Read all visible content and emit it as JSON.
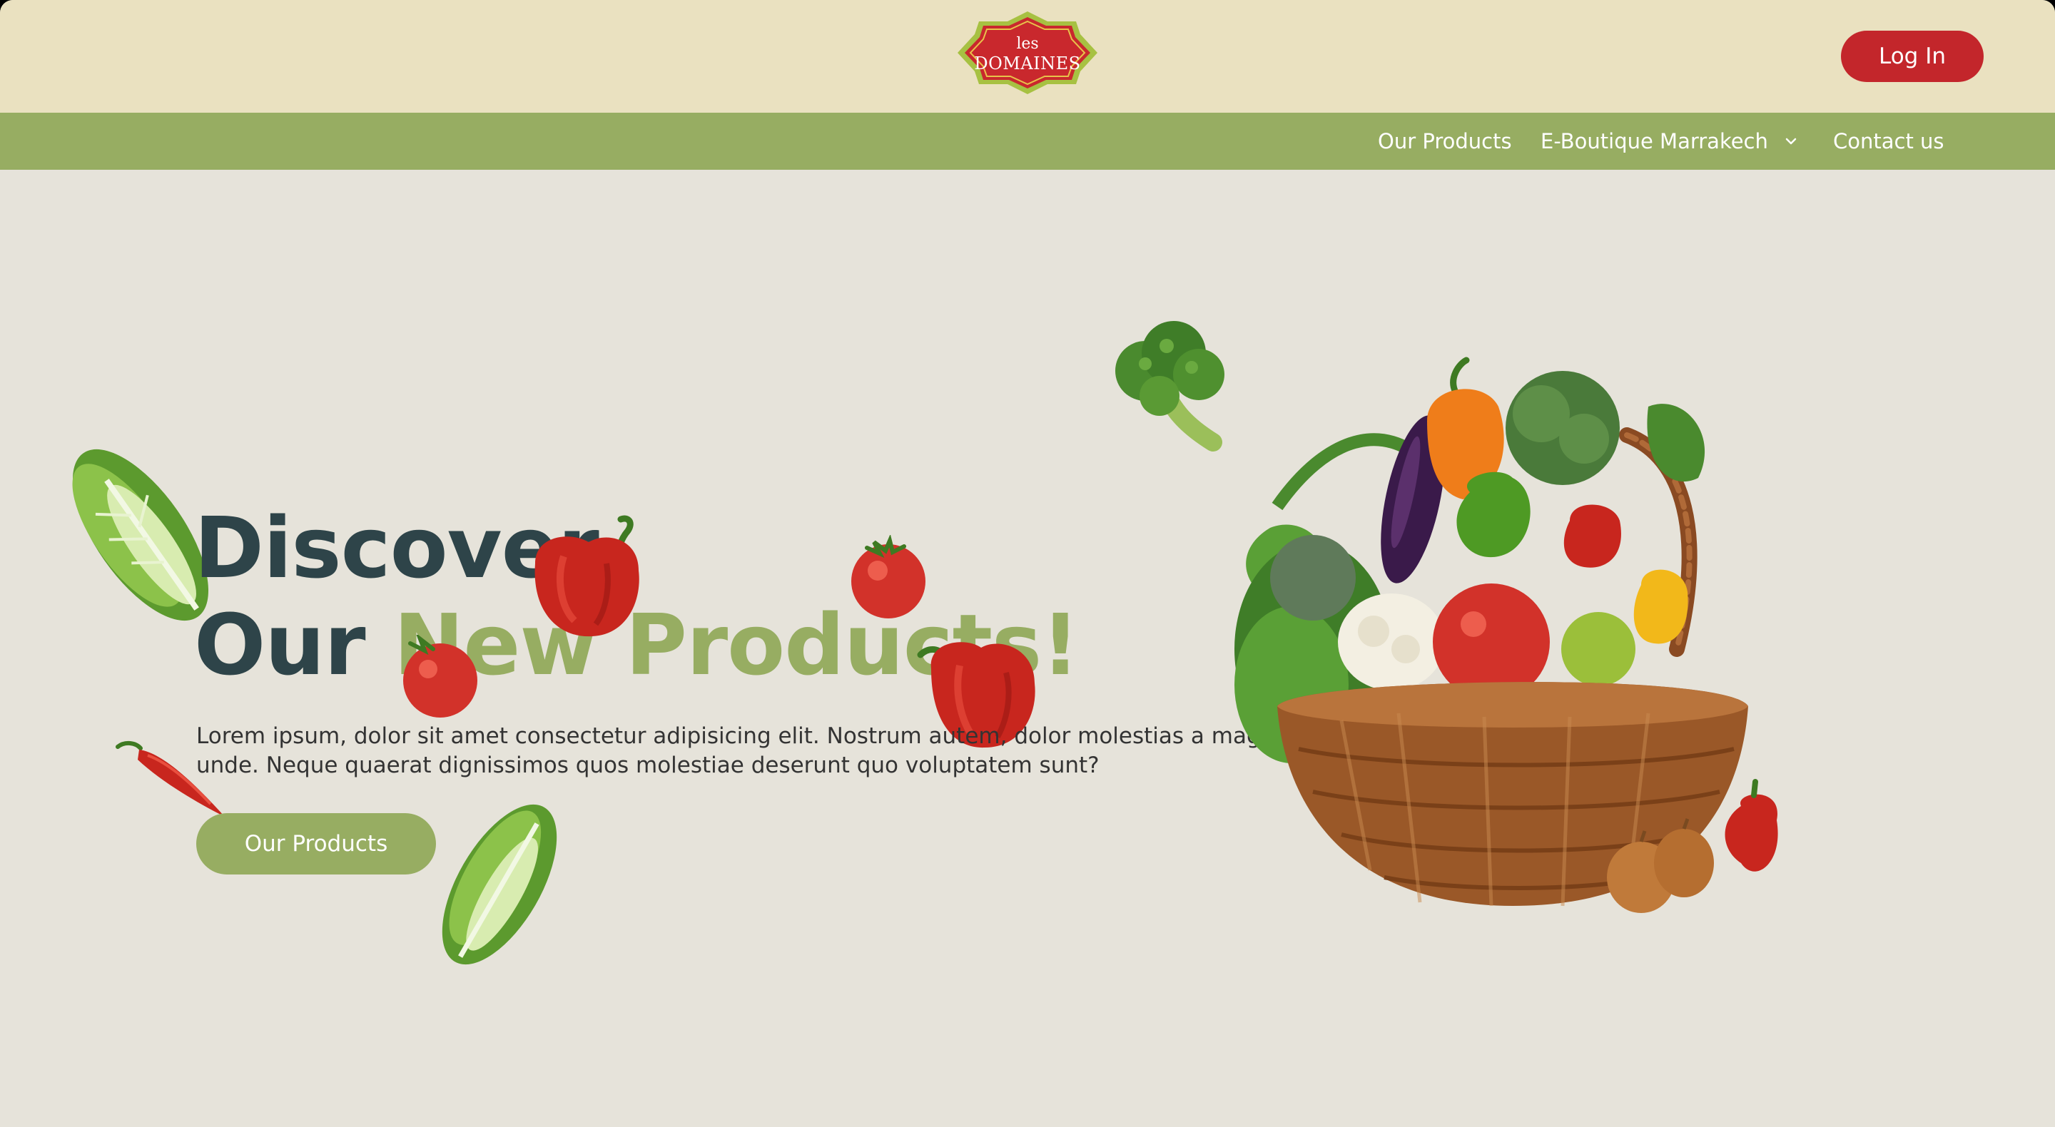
{
  "colors": {
    "topbar_bg": "#eae1c0",
    "nav_bg": "#97ad62",
    "hero_bg": "#e6e3da",
    "accent_green": "#97ad62",
    "title_dark": "#2e4449",
    "brand_red": "#c3262b"
  },
  "header": {
    "logo": {
      "line1": "les",
      "line2": "DOMAINES",
      "icon": "les-domaines-logo"
    },
    "login_label": "Log In"
  },
  "nav": {
    "items": [
      {
        "label": "Our Products"
      },
      {
        "label": "E-Boutique Marrakech",
        "icon": "chevron-down-icon"
      },
      {
        "label": "Contact us"
      }
    ]
  },
  "hero": {
    "title_line1": "Discover",
    "title_line2_plain": "Our",
    "title_line2_accent": "New Products!",
    "description_line1": "Lorem ipsum, dolor sit amet consectetur adipisicing elit. Nostrum autem, dolor molestias a magni",
    "description_line2": "unde. Neque quaerat dignissimos quos molestiae deserunt quo voluptatem sunt?",
    "cta_label": "Our Products",
    "images": [
      "lettuce-image",
      "bell-pepper-image",
      "tomato-image",
      "chili-pepper-image",
      "broccoli-image",
      "vegetable-basket-image"
    ]
  }
}
